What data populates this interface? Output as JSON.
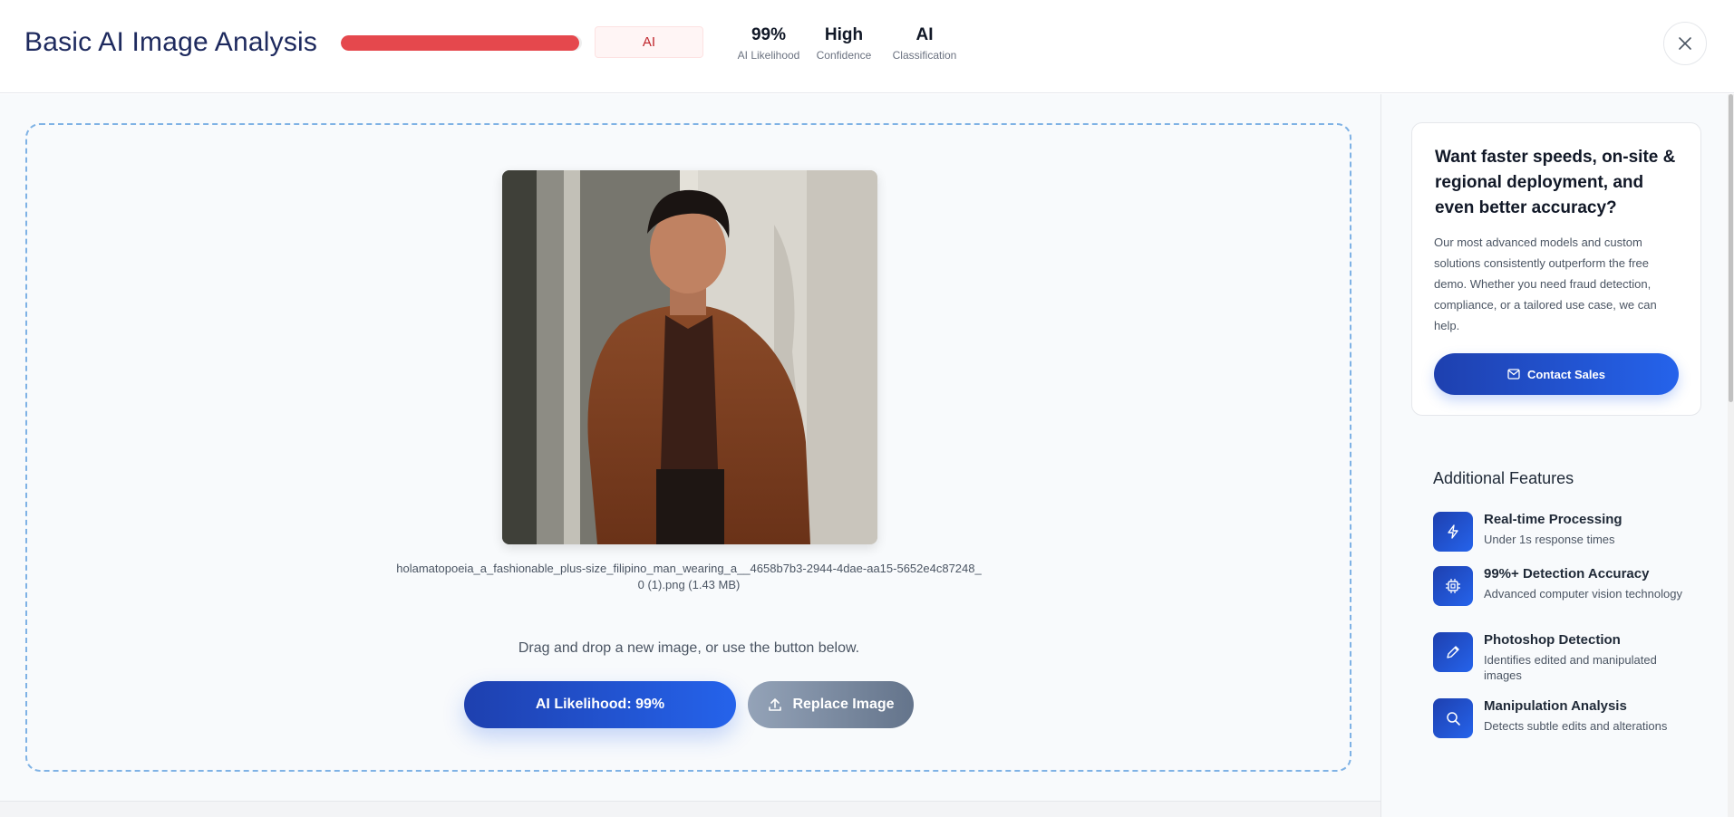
{
  "header": {
    "title": "Basic AI Image Analysis",
    "ai_probability": 0.99,
    "classification_pill": "AI",
    "stats": [
      {
        "value": "99%",
        "label": "AI Likelihood"
      },
      {
        "value": "High",
        "label": "Confidence"
      },
      {
        "value": "AI",
        "label": "Classification"
      }
    ]
  },
  "upload": {
    "filename_line1": "holamatopoeia_a_fashionable_plus-size_filipino_man_wearing_a__4658b7b3-2944-4dae-aa15-5652e4c87248_",
    "filename_line2": "0 (1).png (1.43 MB)",
    "hint": "Drag and drop a new image, or use the button below.",
    "result_button": "AI Likelihood: 99%",
    "replace_button": "Replace Image"
  },
  "promo": {
    "heading": "Want faster speeds, on-site & regional deployment, and even better accuracy?",
    "body": "Our most advanced models and custom solutions consistently outperform the free demo. Whether you need fraud detection, compliance, or a tailored use case, we can help.",
    "button": "Contact Sales"
  },
  "features": {
    "title": "Additional Features",
    "items": [
      {
        "title": "Real-time Processing",
        "desc": "Under 1s response times",
        "icon": "lightning-icon"
      },
      {
        "title": "99%+ Detection Accuracy",
        "desc": "Advanced computer vision technology",
        "icon": "chip-icon"
      },
      {
        "title": "Photoshop Detection",
        "desc": "Identifies edited and manipulated images",
        "icon": "pencil-icon"
      },
      {
        "title": "Manipulation Analysis",
        "desc": "Detects subtle edits and alterations",
        "icon": "search-icon"
      }
    ]
  },
  "colors": {
    "accent": "#2563eb",
    "danger": "#e5484d",
    "title": "#1e2a5e"
  }
}
